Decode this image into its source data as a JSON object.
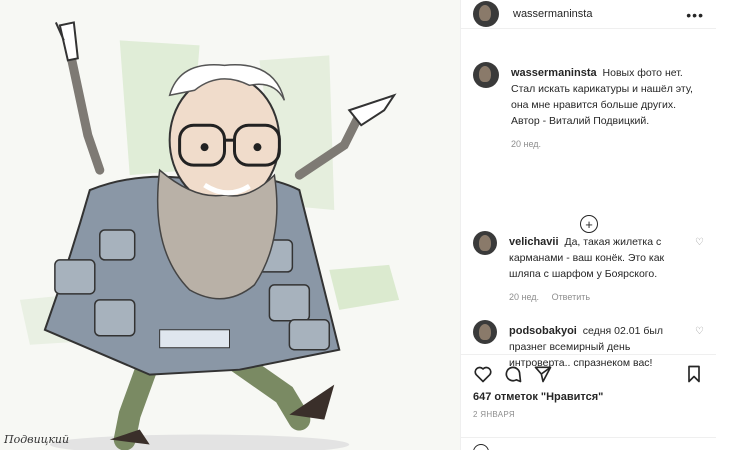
{
  "post": {
    "author": "wassermaninsta",
    "more_icon": "more-horizontal-icon",
    "image_signature": "Подвицкий"
  },
  "comments": [
    {
      "username": "wassermaninsta",
      "text": "Новых фото нет. Стал искать карикатуры и нашёл эту, она мне нравится больше других. Автор - Виталий Подвицкий.",
      "time": "20 нед."
    },
    {
      "username": "velichavii",
      "text": "Да, такая жилетка с карманами - ваш конёк. Это как шляпа с шарфом у Боярского.",
      "time": "20 нед.",
      "reply": "Ответить"
    },
    {
      "username": "podsobakyoi",
      "text": "седня 02.01 был празнег всемирный день интроверта.. спразнеком вас!"
    }
  ],
  "load_more_icon": "plus-circle-icon",
  "actions": {
    "likes": "647 отметок \"Нравится\"",
    "date": "2 ЯНВАРЯ"
  }
}
